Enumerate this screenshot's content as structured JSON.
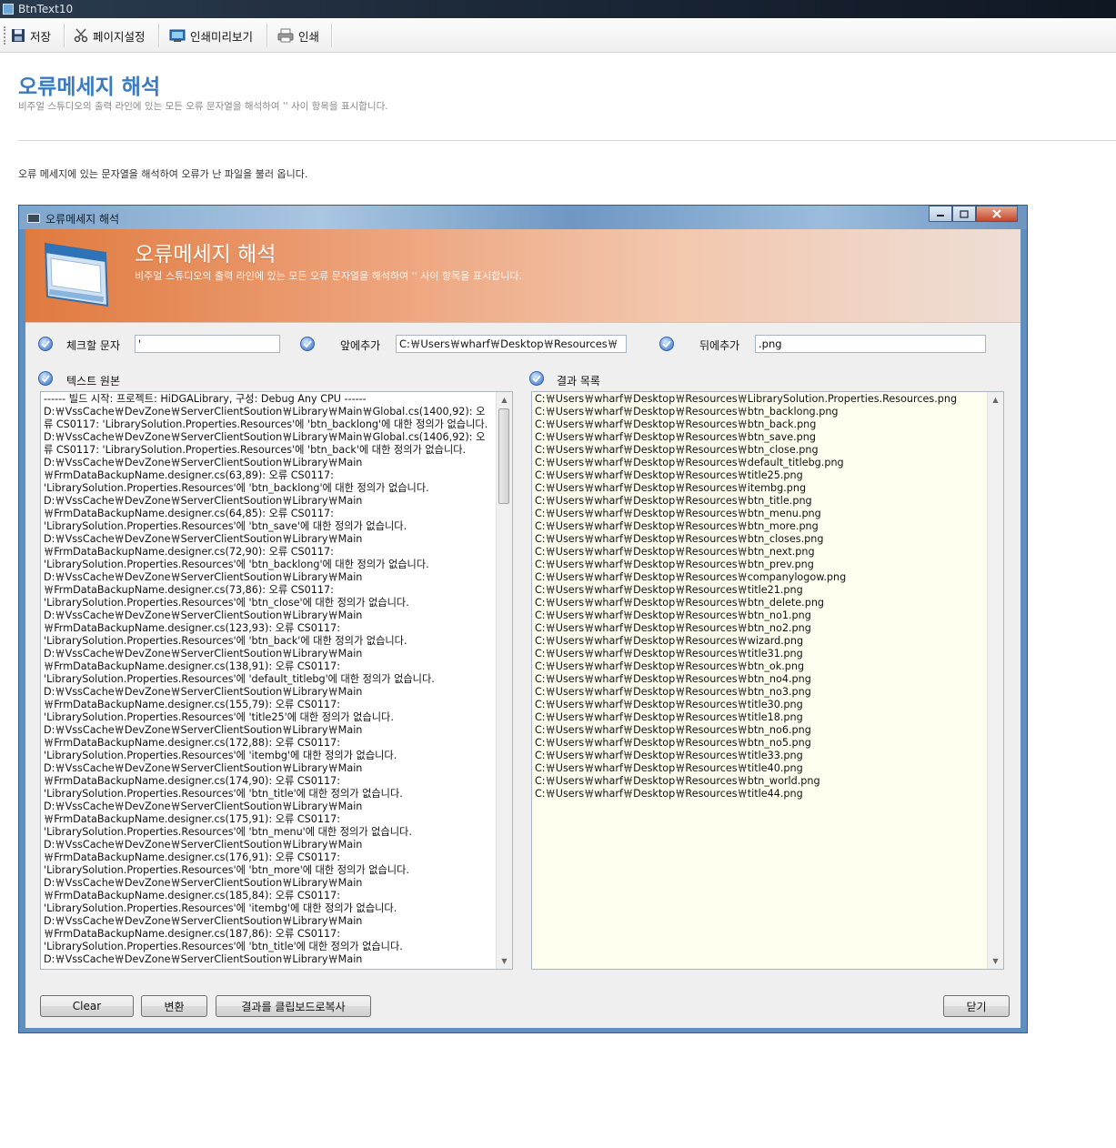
{
  "app_title": "BtnText10",
  "toolbar": {
    "save": "저장",
    "page_setup": "페이지설정",
    "print_preview": "인쇄미리보기",
    "print": "인쇄"
  },
  "page": {
    "title": "오류메세지 해석",
    "subtitle": "비주얼 스튜디오의 출력 라인에 있는 모든 오류 문자열을 해석하여 '' 사이 항목을 표시합니다.",
    "description": "오류 메세지에 있는 문자열을 해석하여 오류가 난 파일을 불러 옵니다."
  },
  "window": {
    "title": "오류메세지 해석",
    "banner_title": "오류메세지 해석",
    "banner_subtitle": "비주얼 스튜디오의 출력 라인에 있는 모든 오류 문자열을 해석하여 '' 사이 항목을 표시합니다.",
    "check_char_label": "체크할 문자",
    "check_char_value": "'",
    "prefix_label": "앞에추가",
    "prefix_value": "C:￦Users￦wharf￦Desktop￦Resources￦",
    "suffix_label": "뒤에추가",
    "suffix_value": ".png",
    "source_label": "텍스트 원본",
    "result_label": "결과 목록",
    "clear_button": "Clear",
    "convert_button": "변환",
    "copy_button": "결과를 클립보드로복사",
    "close_button": "닫기"
  },
  "source_lines": [
    "------ 빌드 시작: 프로젝트: HiDGALibrary, 구성: Debug Any CPU ------",
    "D:￦VssCache￦DevZone￦ServerClientSoution￦Library￦Main￦Global.cs(1400,92): 오",
    "류 CS0117: 'LibrarySolution.Properties.Resources'에 'btn_backlong'에 대한 정의가 없습니다.",
    "D:￦VssCache￦DevZone￦ServerClientSoution￦Library￦Main￦Global.cs(1406,92): 오",
    "류 CS0117: 'LibrarySolution.Properties.Resources'에 'btn_back'에 대한 정의가 없습니다.",
    "D:￦VssCache￦DevZone￦ServerClientSoution￦Library￦Main",
    "￦FrmDataBackupName.designer.cs(63,89): 오류 CS0117:",
    "'LibrarySolution.Properties.Resources'에 'btn_backlong'에 대한 정의가 없습니다.",
    "D:￦VssCache￦DevZone￦ServerClientSoution￦Library￦Main",
    "￦FrmDataBackupName.designer.cs(64,85): 오류 CS0117:",
    "'LibrarySolution.Properties.Resources'에 'btn_save'에 대한 정의가 없습니다.",
    "D:￦VssCache￦DevZone￦ServerClientSoution￦Library￦Main",
    "￦FrmDataBackupName.designer.cs(72,90): 오류 CS0117:",
    "'LibrarySolution.Properties.Resources'에 'btn_backlong'에 대한 정의가 없습니다.",
    "D:￦VssCache￦DevZone￦ServerClientSoution￦Library￦Main",
    "￦FrmDataBackupName.designer.cs(73,86): 오류 CS0117:",
    "'LibrarySolution.Properties.Resources'에 'btn_close'에 대한 정의가 없습니다.",
    "D:￦VssCache￦DevZone￦ServerClientSoution￦Library￦Main",
    "￦FrmDataBackupName.designer.cs(123,93): 오류 CS0117:",
    "'LibrarySolution.Properties.Resources'에 'btn_back'에 대한 정의가 없습니다.",
    "D:￦VssCache￦DevZone￦ServerClientSoution￦Library￦Main",
    "￦FrmDataBackupName.designer.cs(138,91): 오류 CS0117:",
    "'LibrarySolution.Properties.Resources'에 'default_titlebg'에 대한 정의가 없습니다.",
    "D:￦VssCache￦DevZone￦ServerClientSoution￦Library￦Main",
    "￦FrmDataBackupName.designer.cs(155,79): 오류 CS0117:",
    "'LibrarySolution.Properties.Resources'에 'title25'에 대한 정의가 없습니다.",
    "D:￦VssCache￦DevZone￦ServerClientSoution￦Library￦Main",
    "￦FrmDataBackupName.designer.cs(172,88): 오류 CS0117:",
    "'LibrarySolution.Properties.Resources'에 'itembg'에 대한 정의가 없습니다.",
    "D:￦VssCache￦DevZone￦ServerClientSoution￦Library￦Main",
    "￦FrmDataBackupName.designer.cs(174,90): 오류 CS0117:",
    "'LibrarySolution.Properties.Resources'에 'btn_title'에 대한 정의가 없습니다.",
    "D:￦VssCache￦DevZone￦ServerClientSoution￦Library￦Main",
    "￦FrmDataBackupName.designer.cs(175,91): 오류 CS0117:",
    "'LibrarySolution.Properties.Resources'에 'btn_menu'에 대한 정의가 없습니다.",
    "D:￦VssCache￦DevZone￦ServerClientSoution￦Library￦Main",
    "￦FrmDataBackupName.designer.cs(176,91): 오류 CS0117:",
    "'LibrarySolution.Properties.Resources'에 'btn_more'에 대한 정의가 없습니다.",
    "D:￦VssCache￦DevZone￦ServerClientSoution￦Library￦Main",
    "￦FrmDataBackupName.designer.cs(185,84): 오류 CS0117:",
    "'LibrarySolution.Properties.Resources'에 'itembg'에 대한 정의가 없습니다.",
    "D:￦VssCache￦DevZone￦ServerClientSoution￦Library￦Main",
    "￦FrmDataBackupName.designer.cs(187,86): 오류 CS0117:",
    "'LibrarySolution.Properties.Resources'에 'btn_title'에 대한 정의가 없습니다.",
    "D:￦VssCache￦DevZone￦ServerClientSoution￦Library￦Main"
  ],
  "result_lines": [
    "C:￦Users￦wharf￦Desktop￦Resources￦LibrarySolution.Properties.Resources.png",
    "C:￦Users￦wharf￦Desktop￦Resources￦btn_backlong.png",
    "C:￦Users￦wharf￦Desktop￦Resources￦btn_back.png",
    "C:￦Users￦wharf￦Desktop￦Resources￦btn_save.png",
    "C:￦Users￦wharf￦Desktop￦Resources￦btn_close.png",
    "C:￦Users￦wharf￦Desktop￦Resources￦default_titlebg.png",
    "C:￦Users￦wharf￦Desktop￦Resources￦title25.png",
    "C:￦Users￦wharf￦Desktop￦Resources￦itembg.png",
    "C:￦Users￦wharf￦Desktop￦Resources￦btn_title.png",
    "C:￦Users￦wharf￦Desktop￦Resources￦btn_menu.png",
    "C:￦Users￦wharf￦Desktop￦Resources￦btn_more.png",
    "C:￦Users￦wharf￦Desktop￦Resources￦btn_closes.png",
    "C:￦Users￦wharf￦Desktop￦Resources￦btn_next.png",
    "C:￦Users￦wharf￦Desktop￦Resources￦btn_prev.png",
    "C:￦Users￦wharf￦Desktop￦Resources￦companylogow.png",
    "C:￦Users￦wharf￦Desktop￦Resources￦title21.png",
    "C:￦Users￦wharf￦Desktop￦Resources￦btn_delete.png",
    "C:￦Users￦wharf￦Desktop￦Resources￦btn_no1.png",
    "C:￦Users￦wharf￦Desktop￦Resources￦btn_no2.png",
    "C:￦Users￦wharf￦Desktop￦Resources￦wizard.png",
    "C:￦Users￦wharf￦Desktop￦Resources￦title31.png",
    "C:￦Users￦wharf￦Desktop￦Resources￦btn_ok.png",
    "C:￦Users￦wharf￦Desktop￦Resources￦btn_no4.png",
    "C:￦Users￦wharf￦Desktop￦Resources￦btn_no3.png",
    "C:￦Users￦wharf￦Desktop￦Resources￦title30.png",
    "C:￦Users￦wharf￦Desktop￦Resources￦title18.png",
    "C:￦Users￦wharf￦Desktop￦Resources￦btn_no6.png",
    "C:￦Users￦wharf￦Desktop￦Resources￦btn_no5.png",
    "C:￦Users￦wharf￦Desktop￦Resources￦title33.png",
    "C:￦Users￦wharf￦Desktop￦Resources￦title40.png",
    "C:￦Users￦wharf￦Desktop￦Resources￦btn_world.png",
    "C:￦Users￦wharf￦Desktop￦Resources￦title44.png"
  ],
  "colors": {
    "page_title": "#3a7bbf",
    "result_background": "#fffff0",
    "banner_start": "#e07a3f"
  }
}
